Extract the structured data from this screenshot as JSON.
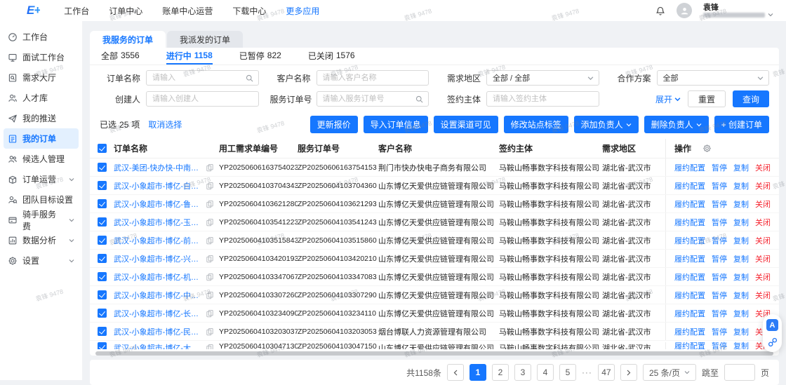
{
  "watermark": {
    "text": "袁锋 9478"
  },
  "header": {
    "logo": "E+",
    "nav": [
      {
        "label": "工作台"
      },
      {
        "label": "订单中心"
      },
      {
        "label": "账单中心运营"
      },
      {
        "label": "下载中心"
      },
      {
        "label": "更多应用",
        "active": true
      }
    ],
    "user": {
      "name": "袁锋"
    }
  },
  "sidebar": {
    "items": [
      {
        "label": "工作台"
      },
      {
        "label": "面试工作台"
      },
      {
        "label": "需求大厅"
      },
      {
        "label": "人才库"
      },
      {
        "label": "我的推送"
      },
      {
        "label": "我的订单",
        "active": true
      },
      {
        "label": "候选人管理"
      },
      {
        "label": "订单运营",
        "expandable": true
      },
      {
        "label": "团队目标设置"
      },
      {
        "label": "骑手服务费",
        "expandable": true
      },
      {
        "label": "数据分析",
        "expandable": true
      },
      {
        "label": "设置",
        "expandable": true
      }
    ]
  },
  "tabs": [
    {
      "label": "我服务的订单",
      "active": true
    },
    {
      "label": "我派发的订单"
    }
  ],
  "status_filters": [
    {
      "label": "全部",
      "count": "3556"
    },
    {
      "label": "进行中",
      "count": "1158",
      "active": true
    },
    {
      "label": "已暂停",
      "count": "822"
    },
    {
      "label": "已关闭",
      "count": "1576"
    }
  ],
  "filters": {
    "order_name": {
      "label": "订单名称",
      "placeholder": "请输入"
    },
    "customer_name": {
      "label": "客户名称",
      "placeholder": "请输入客户名称"
    },
    "region": {
      "label": "需求地区",
      "value": "全部 / 全部"
    },
    "plan": {
      "label": "合作方案",
      "value": "全部"
    },
    "creator": {
      "label": "创建人",
      "placeholder": "请输入创建人"
    },
    "service_order_no": {
      "label": "服务订单号",
      "placeholder": "请输入服务订单号"
    },
    "signer": {
      "label": "签约主体",
      "placeholder": "请输入签约主体"
    },
    "expand": "展开",
    "reset": "重置",
    "search": "查询"
  },
  "selection": {
    "prefix": "已选",
    "count": "25",
    "suffix": "项",
    "clear": "取消选择"
  },
  "actions": {
    "update_quote": "更新报价",
    "import_order": "导入订单信息",
    "channel_visible": "设置渠道可见",
    "edit_site_tag": "修改站点标签",
    "add_owner": "添加负责人",
    "remove_owner": "删除负责人",
    "create_order": "+ 创建订单"
  },
  "table": {
    "columns": [
      "订单名称",
      "用工需求单编号",
      "服务订单号",
      "客户名称",
      "签约主体",
      "需求地区",
      "操作"
    ],
    "row_actions": [
      "履约配置",
      "暂停",
      "复制",
      "关闭"
    ],
    "rows": [
      {
        "name": "武汉-美团-快办快-中南路站",
        "req_no": "YP20250606163754023",
        "order_no": "ZP20250606163754153",
        "customer": "荆门市快办快电子商务有限公司",
        "signer": "马鞍山畅事数字科技有限公司",
        "region": "湖北省-武汉市"
      },
      {
        "name": "武汉-小象超市-博亿-白沙六路站",
        "req_no": "YP20250604103704343",
        "order_no": "ZP20250604103704360",
        "customer": "山东博亿天爱供应链管理有限公司",
        "signer": "马鞍山畅事数字科技有限公司",
        "region": "湖北省-武汉市"
      },
      {
        "name": "武汉-小象超市-博亿-鲁巷站",
        "req_no": "YP20250604103621280",
        "order_no": "ZP20250604103621293",
        "customer": "山东博亿天爱供应链管理有限公司",
        "signer": "马鞍山畅事数字科技有限公司",
        "region": "湖北省-武汉市"
      },
      {
        "name": "武汉-小象超市-博亿-玉龙路站",
        "req_no": "YP20250604103541223",
        "order_no": "ZP20250604103541243",
        "customer": "山东博亿天爱供应链管理有限公司",
        "signer": "马鞍山畅事数字科技有限公司",
        "region": "湖北省-武汉市"
      },
      {
        "name": "武汉-小象超市-博亿-前进二路站",
        "req_no": "YP20250604103515843",
        "order_no": "ZP20250604103515860",
        "customer": "山东博亿天爱供应链管理有限公司",
        "signer": "马鞍山畅事数字科技有限公司",
        "region": "湖北省-武汉市"
      },
      {
        "name": "武汉-小象超市-博亿-兴业路站",
        "req_no": "YP20250604103420193",
        "order_no": "ZP20250604103420210",
        "customer": "山东博亿天爱供应链管理有限公司",
        "signer": "马鞍山畅事数字科技有限公司",
        "region": "湖北省-武汉市"
      },
      {
        "name": "武汉-小象超市-博亿-机电路站",
        "req_no": "YP20250604103347067",
        "order_no": "ZP20250604103347083",
        "customer": "山东博亿天爱供应链管理有限公司",
        "signer": "马鞍山畅事数字科技有限公司",
        "region": "湖北省-武汉市"
      },
      {
        "name": "武汉-小象超市-博亿-中山公园站",
        "req_no": "YP20250604103307260",
        "order_no": "ZP20250604103307290",
        "customer": "山东博亿天爱供应链管理有限公司",
        "signer": "马鞍山畅事数字科技有限公司",
        "region": "湖北省-武汉市"
      },
      {
        "name": "武汉-小象超市-博亿-长丰站",
        "req_no": "YP20250604103234090",
        "order_no": "ZP20250604103234110",
        "customer": "山东博亿天爱供应链管理有限公司",
        "signer": "马鞍山畅事数字科技有限公司",
        "region": "湖北省-武汉市"
      },
      {
        "name": "武汉-小象超市-博亿-民族大道站",
        "req_no": "YP20250604103203037",
        "order_no": "ZP20250604103203053",
        "customer": "烟台博联人力资源管理有限公司",
        "signer": "马鞍山畅事数字科技有限公司",
        "region": "湖北省-武汉市"
      },
      {
        "name": "武汉-小象超市-博亿-大智路站",
        "req_no": "YP20250604103047130",
        "order_no": "ZP20250604103047150",
        "customer": "山东博亿天爱供应链管理有限公司",
        "signer": "马鞍山畅事数字科技有限公司",
        "region": "湖北省-武汉市",
        "partial": true
      }
    ]
  },
  "pagination": {
    "total": "共1158条",
    "pages": [
      "1",
      "2",
      "3",
      "4",
      "5"
    ],
    "ellipsis": "···",
    "last_page": "47",
    "page_size": "25 条/页",
    "jump_prefix": "跳至",
    "jump_suffix": "页"
  }
}
